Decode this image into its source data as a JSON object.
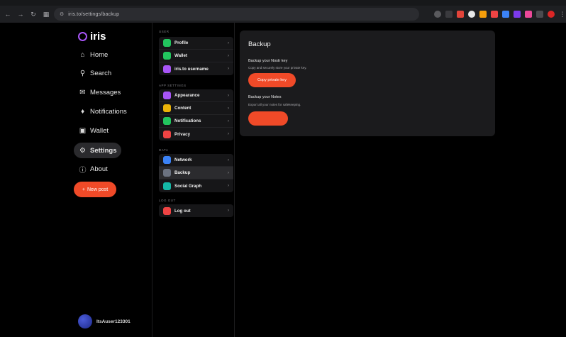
{
  "browser": {
    "url": "iris.to/settings/backup"
  },
  "sidebar": {
    "logo": "iris",
    "items": [
      {
        "label": "Home",
        "icon": "home-icon"
      },
      {
        "label": "Search",
        "icon": "search-icon"
      },
      {
        "label": "Messages",
        "icon": "messages-icon"
      },
      {
        "label": "Notifications",
        "icon": "bell-icon"
      },
      {
        "label": "Wallet",
        "icon": "wallet-icon"
      },
      {
        "label": "Settings",
        "icon": "gear-icon"
      },
      {
        "label": "About",
        "icon": "info-icon"
      }
    ],
    "new_post_label": "New post",
    "username": "ItsAuser123301"
  },
  "settings_menu": {
    "groups": [
      {
        "title": "USER",
        "items": [
          {
            "label": "Profile",
            "color": "#22c55e"
          },
          {
            "label": "Wallet",
            "color": "#22c55e"
          },
          {
            "label": "iris.to username",
            "color": "#a855f7"
          }
        ]
      },
      {
        "title": "APP SETTINGS",
        "items": [
          {
            "label": "Appearance",
            "color": "#a855f7"
          },
          {
            "label": "Content",
            "color": "#eab308"
          },
          {
            "label": "Notifications",
            "color": "#22c55e"
          },
          {
            "label": "Privacy",
            "color": "#ef4444"
          }
        ]
      },
      {
        "title": "DATA",
        "items": [
          {
            "label": "Network",
            "color": "#3b82f6"
          },
          {
            "label": "Backup",
            "color": "#6b7280"
          },
          {
            "label": "Social Graph",
            "color": "#14b8a6"
          }
        ]
      },
      {
        "title": "LOG OUT",
        "items": [
          {
            "label": "Log out",
            "color": "#ef4444"
          }
        ]
      }
    ],
    "selected": "Backup"
  },
  "main": {
    "title": "Backup",
    "key_section": {
      "title": "Backup your Nostr key",
      "description": "Copy and securely store your private key.",
      "button": "Copy private key"
    },
    "notes_section": {
      "title": "Backup your Notes",
      "description": "Export all your notes for safekeeping.",
      "button": ""
    }
  },
  "colors": {
    "accent": "#f04a28",
    "brand": "#a855f7",
    "background": "#000000",
    "panel": "#1b1b1d"
  }
}
